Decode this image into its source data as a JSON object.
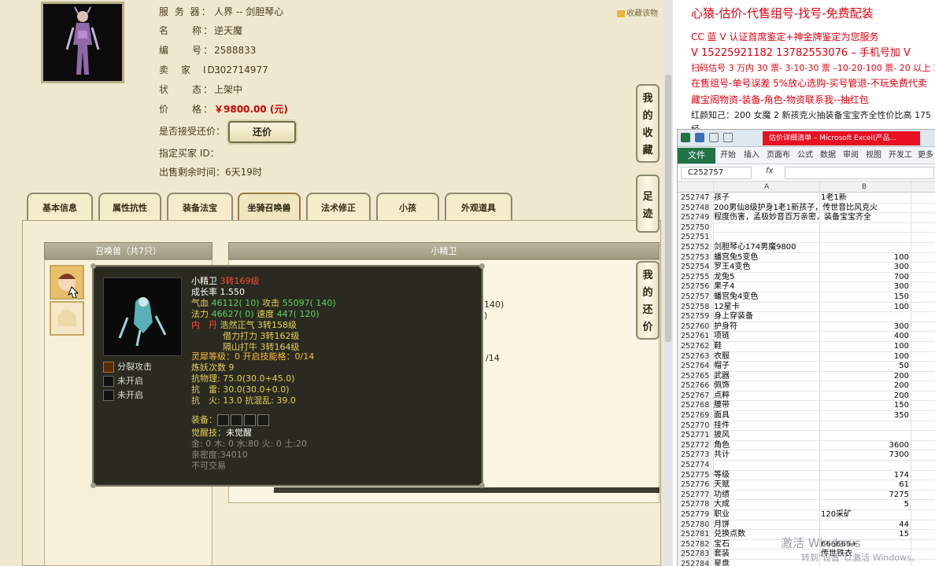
{
  "seller": {
    "server_label": "服 务 器：",
    "server": "人界 -- 剑胆琴心",
    "name_label": "名　　称：",
    "name": "逆天魔",
    "id_label": "编　　号：",
    "id": "2588833",
    "seller_label": "卖　家　ID：",
    "seller_id": "302714977",
    "status_label": "状　　态：",
    "status": "上架中",
    "price_label": "价　　格：",
    "price": "￥9800.00 (元)",
    "counter_label": "是否接受还价：",
    "counter_btn": "还价",
    "buyer_label": "指定买家 ID：",
    "time_label": "出售剩余时间：",
    "time": "6天19时",
    "favorite": "收藏该物"
  },
  "tabs": [
    {
      "label": "基本信息"
    },
    {
      "label": "属性抗性"
    },
    {
      "label": "装备法宝"
    },
    {
      "label": "坐骑召唤兽"
    },
    {
      "label": "法术修正"
    },
    {
      "label": "小孩"
    },
    {
      "label": "外观道具"
    }
  ],
  "side_buttons": {
    "fav": "我的收藏",
    "trace": "足迹",
    "counter": "我的还价"
  },
  "pets": {
    "list_header": "召唤兽（共7只）",
    "detail_header": "小精卫"
  },
  "popup": {
    "name": "小精卫",
    "level": "3转169级",
    "growth": "成长率 1.550",
    "hp_label": "气血",
    "hp": "46112( 10)",
    "atk_label": "攻击",
    "atk": "55097( 140)",
    "mp_label": "法力",
    "mp": "46627( 0)",
    "spd_label": "速度",
    "spd": "447( 120)",
    "neidan_label": "内　丹",
    "neidan1": "浩然正气 3转158级",
    "neidan2": "借力打力 3转162级",
    "neidan3": "隔山打牛 3转164级",
    "spirit": "灵犀等级：0 开启技能格：0/14",
    "demon": "炼妖次数 9",
    "phys_res": "抗物理: 75.0(30.0+45.0)",
    "thunder_res": "抗　雷: 30.0(30.0+0.0)",
    "fire_res": "抗　火: 13.0 抗混乱: 39.0",
    "equip_label": "装备：",
    "awaken_label": "觉醒技：",
    "awaken": "未觉醒",
    "elements": "金: 0 木: 0 水:80 火: 0 土:20",
    "intimacy": "亲密度:34010",
    "tradable": "不可交易",
    "skills": [
      {
        "name": "分裂攻击"
      },
      {
        "name": "未开启"
      },
      {
        "name": "未开启"
      }
    ]
  },
  "behind_text": {
    "t1": "140)",
    "t2": ")",
    "t3": "/14"
  },
  "notes": {
    "title": "心猿-估价-代售组号-找号-免费配装",
    "l1": "CC 蓝 V 认证首席鉴定+神金牌鉴定为您服务",
    "l2": "V 15225921182   13782553076 – 手机号加 V",
    "l3": "扫码估号 3 万内 30 票- 3-10-30 票  –10-20-100 票- 20 以上 150",
    "l4": "在售组号-单号误差 5%放心选购-买号管退-不玩免费代卖",
    "l5": "藏宝阁物资-装备-角色-物资联系我--抽红包",
    "l6": "红颜知己：200 女魔 2 新孩克火抽装备宝宝齐全性价比高 175",
    "l7": "经"
  },
  "excel": {
    "title": "估价详细清单 – Microsoft Excel(产品...",
    "file_tab": "文件",
    "ribbon": [
      "开始",
      "插入",
      "页面布",
      "公式",
      "数据",
      "审阅",
      "视图",
      "开发工",
      "更多"
    ],
    "name_box": "C252757",
    "fx": "fx",
    "col_a": "A",
    "col_b": "B",
    "rows": [
      {
        "n": "252747",
        "a": "孩子",
        "b": "",
        "bt": "1老1新"
      },
      {
        "n": "252748",
        "a": "200男仙8级护身1老1新孩子，传世音比风克火",
        "b": "",
        "bt": ""
      },
      {
        "n": "252749",
        "a": "程度伤害，孟极妙音百万亲密，装备宝宝齐全",
        "b": "",
        "bt": ""
      },
      {
        "n": "252750",
        "a": "",
        "b": "",
        "bt": ""
      },
      {
        "n": "252751",
        "a": "",
        "b": "",
        "bt": ""
      },
      {
        "n": "252752",
        "a": "剑胆琴心174男魔9800",
        "b": "",
        "bt": ""
      },
      {
        "n": "252753",
        "a": "蟠宫兔5变色",
        "b": "100",
        "bt": ""
      },
      {
        "n": "252754",
        "a": "罗王4变色",
        "b": "300",
        "bt": ""
      },
      {
        "n": "252755",
        "a": "龙兔5",
        "b": "700",
        "bt": ""
      },
      {
        "n": "252756",
        "a": "果子4",
        "b": "300",
        "bt": ""
      },
      {
        "n": "252757",
        "a": "蟠宫兔4变色",
        "b": "150",
        "bt": ""
      },
      {
        "n": "252758",
        "a": "12星卡",
        "b": "100",
        "bt": ""
      },
      {
        "n": "252759",
        "a": "身上穿装备",
        "b": "",
        "bt": ""
      },
      {
        "n": "252760",
        "a": "护身符",
        "b": "300",
        "bt": ""
      },
      {
        "n": "252761",
        "a": "项链",
        "b": "400",
        "bt": ""
      },
      {
        "n": "252762",
        "a": "鞋",
        "b": "100",
        "bt": ""
      },
      {
        "n": "252763",
        "a": "衣服",
        "b": "100",
        "bt": ""
      },
      {
        "n": "252764",
        "a": "帽子",
        "b": "50",
        "bt": ""
      },
      {
        "n": "252765",
        "a": "武器",
        "b": "200",
        "bt": ""
      },
      {
        "n": "252766",
        "a": "佩饰",
        "b": "200",
        "bt": ""
      },
      {
        "n": "252767",
        "a": "点粹",
        "b": "200",
        "bt": ""
      },
      {
        "n": "252768",
        "a": "腰带",
        "b": "150",
        "bt": ""
      },
      {
        "n": "252769",
        "a": "面具",
        "b": "350",
        "bt": ""
      },
      {
        "n": "252770",
        "a": "挂件",
        "b": "",
        "bt": ""
      },
      {
        "n": "252771",
        "a": "披风",
        "b": "",
        "bt": ""
      },
      {
        "n": "252772",
        "a": "角色",
        "b": "3600",
        "bt": ""
      },
      {
        "n": "252773",
        "a": "共计",
        "b": "7300",
        "bt": ""
      },
      {
        "n": "252774",
        "a": "",
        "b": "",
        "bt": ""
      },
      {
        "n": "252775",
        "a": "等级",
        "b": "174",
        "bt": ""
      },
      {
        "n": "252776",
        "a": "天赋",
        "b": "61",
        "bt": ""
      },
      {
        "n": "252777",
        "a": "功绩",
        "b": "7275",
        "bt": ""
      },
      {
        "n": "252778",
        "a": "大成",
        "b": "5",
        "bt": ""
      },
      {
        "n": "252779",
        "a": "职业",
        "b": "",
        "bt": "120采矿"
      },
      {
        "n": "252780",
        "a": "月饼",
        "b": "44",
        "bt": ""
      },
      {
        "n": "252781",
        "a": "兑换点数",
        "b": "15",
        "bt": ""
      },
      {
        "n": "252782",
        "a": "宝石",
        "b": "",
        "bt": "666666+"
      },
      {
        "n": "252783",
        "a": "套装",
        "b": "",
        "bt": "传世铁衣"
      },
      {
        "n": "252784",
        "a": "星盘",
        "b": "",
        "bt": ""
      }
    ]
  },
  "watermark": {
    "l1": "激活 Windows",
    "l2": "转到\"设置\"以激活 Windows。"
  },
  "colors": {
    "price_red": "#cc0000",
    "note_red": "#e3000f",
    "excel_green": "#217346"
  }
}
